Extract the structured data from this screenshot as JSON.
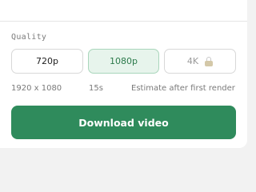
{
  "quality": {
    "label": "Quality",
    "options": [
      {
        "label": "720p",
        "state": "default"
      },
      {
        "label": "1080p",
        "state": "selected"
      },
      {
        "label": "4K",
        "state": "locked"
      }
    ]
  },
  "meta": {
    "resolution": "1920 x 1080",
    "duration": "15s",
    "size_estimate": "Estimate after first render"
  },
  "download": {
    "label": "Download video"
  },
  "colors": {
    "accent": "#2f8b5c",
    "selected_bg": "#e7f4ec",
    "selected_text": "#2c7a4b"
  },
  "icons": {
    "locked": "lock-icon"
  }
}
